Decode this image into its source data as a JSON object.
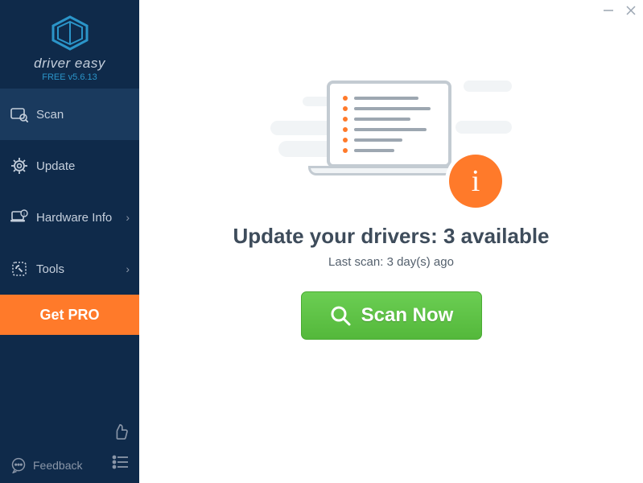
{
  "app": {
    "name": "driver easy",
    "version": "FREE v5.6.13"
  },
  "sidebar": {
    "items": [
      {
        "label": "Scan",
        "icon": "scan-icon",
        "has_chevron": false
      },
      {
        "label": "Update",
        "icon": "gear-icon",
        "has_chevron": false
      },
      {
        "label": "Hardware Info",
        "icon": "hardware-icon",
        "has_chevron": true
      },
      {
        "label": "Tools",
        "icon": "tools-icon",
        "has_chevron": true
      }
    ],
    "get_pro_label": "Get PRO",
    "feedback_label": "Feedback"
  },
  "main": {
    "headline": "Update your drivers: 3 available",
    "last_scan": "Last scan: 3 day(s) ago",
    "scan_button": "Scan Now"
  }
}
